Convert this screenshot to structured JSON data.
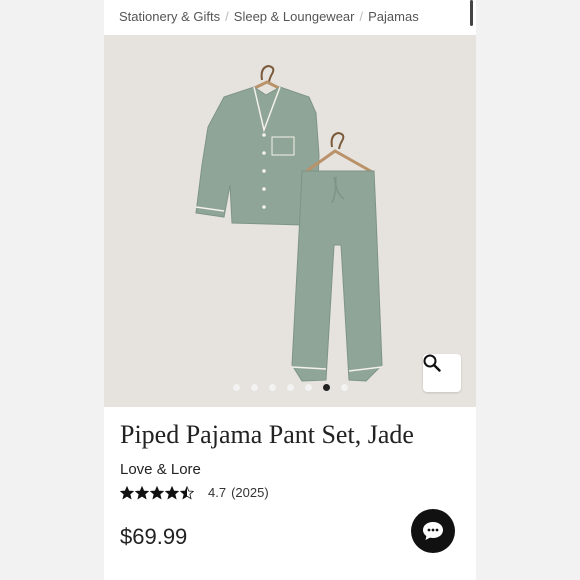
{
  "breadcrumb": {
    "items": [
      "Stationery & Gifts",
      "Sleep & Loungewear",
      "Pajamas"
    ],
    "separator": "/"
  },
  "gallery": {
    "dot_count": 7,
    "active_index": 5
  },
  "product": {
    "title": "Piped Pajama Pant Set, Jade",
    "brand": "Love & Lore",
    "rating_value": "4.7",
    "review_count": "(2025)",
    "stars": 4.5,
    "price": "$69.99"
  },
  "colors": {
    "pajama": "#8fa597",
    "background": "#e6e2dd",
    "piping": "#f4f1ea"
  },
  "icons": {
    "zoom": "magnifier-icon",
    "chat": "chat-bubble-icon"
  }
}
